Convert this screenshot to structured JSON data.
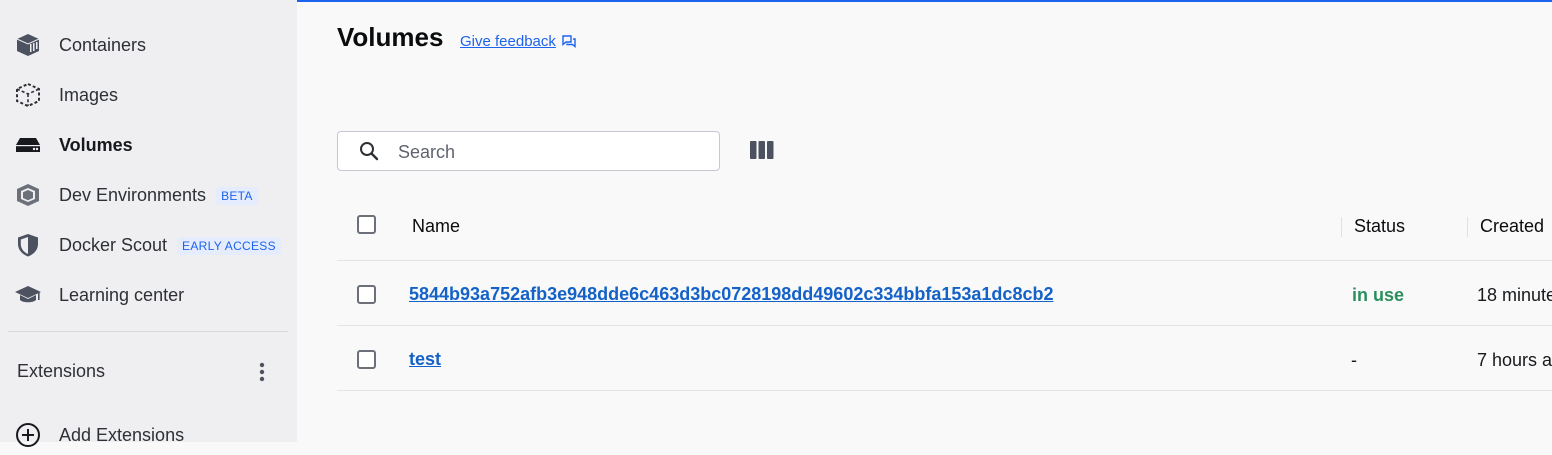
{
  "sidebar": {
    "items": [
      {
        "label": "Containers",
        "icon": "containers-icon"
      },
      {
        "label": "Images",
        "icon": "images-icon"
      },
      {
        "label": "Volumes",
        "icon": "volumes-icon",
        "active": true
      },
      {
        "label": "Dev Environments",
        "icon": "dev-environments-icon",
        "badge": "BETA"
      },
      {
        "label": "Docker Scout",
        "icon": "docker-scout-icon",
        "badge": "EARLY ACCESS"
      },
      {
        "label": "Learning center",
        "icon": "learning-center-icon"
      }
    ],
    "extensions_title": "Extensions",
    "add_extensions_label": "Add Extensions"
  },
  "page": {
    "title": "Volumes",
    "feedback_label": "Give feedback"
  },
  "search": {
    "placeholder": "Search",
    "value": ""
  },
  "table": {
    "columns": [
      "Name",
      "Status",
      "Created"
    ],
    "rows": [
      {
        "name": "5844b93a752afb3e948dde6c463d3bc0728198dd49602c334bbfa153a1dc8cb2",
        "status": "in use",
        "created": "18 minute"
      },
      {
        "name": "test",
        "status": "-",
        "created": "7 hours a"
      }
    ]
  },
  "colors": {
    "accent": "#1d63ed",
    "link": "#1462c7",
    "status_in_use": "#2a8f5d",
    "sidebar_bg": "#efeff2"
  }
}
